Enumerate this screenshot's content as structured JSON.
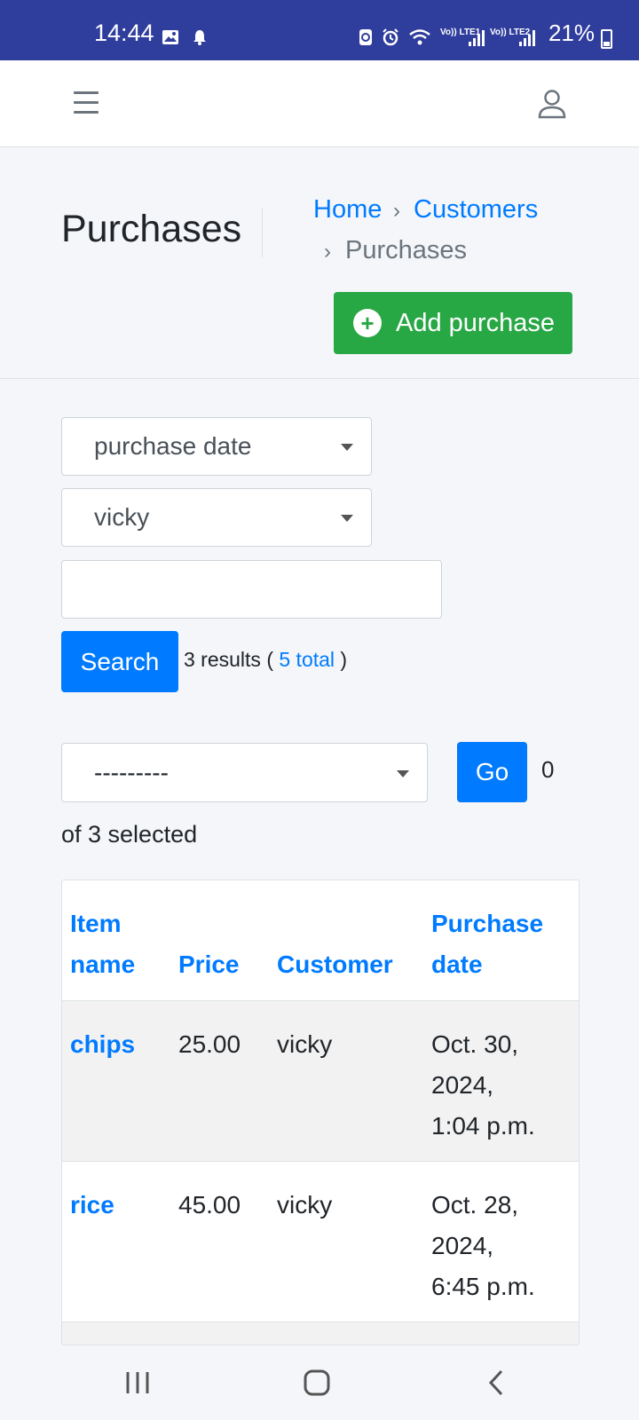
{
  "status_bar": {
    "time": "14:44",
    "battery": "21%",
    "lte1": "Vo)) LTE1",
    "lte2": "Vo)) LTE2"
  },
  "navbar": {
    "menu_icon": "hamburger-icon",
    "user_icon": "user-icon"
  },
  "header": {
    "title": "Purchases",
    "breadcrumb": {
      "home": "Home",
      "customers": "Customers",
      "current": "Purchases",
      "separator": "›"
    },
    "add_button_label": "Add purchase"
  },
  "filters": {
    "field_select": "purchase date",
    "customer_select": "vicky",
    "search_value": "",
    "search_button": "Search",
    "results_prefix": "3 results (",
    "results_total": "5 total",
    "results_suffix": ")"
  },
  "actions": {
    "action_select": "---------",
    "go_button": "Go",
    "selected_count": "0",
    "selected_text": "of 3 selected"
  },
  "table": {
    "headers": {
      "item_name_line1": "Item",
      "item_name_line2": "name",
      "price": "Price",
      "customer": "Customer",
      "date_line1": "Purchase",
      "date_line2": "date"
    },
    "rows": [
      {
        "item": "chips",
        "price": "25.00",
        "customer": "vicky",
        "date_l1": "Oct. 30,",
        "date_l2": "2024,",
        "date_l3": "1:04 p.m."
      },
      {
        "item": "rice",
        "price": "45.00",
        "customer": "vicky",
        "date_l1": "Oct. 28,",
        "date_l2": "2024,",
        "date_l3": "6:45 p.m."
      }
    ]
  },
  "colors": {
    "status_bar": "#2f3d9c",
    "primary": "#007bff",
    "success": "#28a745"
  }
}
